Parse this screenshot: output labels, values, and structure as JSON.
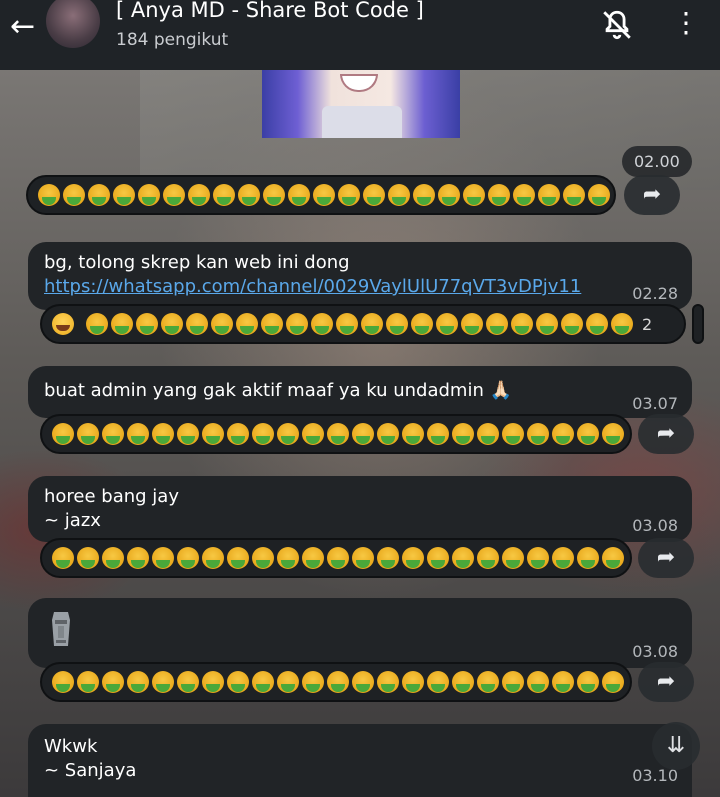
{
  "header": {
    "title": "[ Anya MD - Share Bot Code ]",
    "subtitle": "184 pengikut"
  },
  "icons": {
    "back": "arrow-left-icon",
    "mute": "bell-off-icon",
    "more": "more-vertical-icon",
    "forward": "share-forward-icon",
    "scroll_down": "double-chevron-down-icon"
  },
  "messages": [
    {
      "time": "02.00"
    },
    {
      "text": "bg, tolong skrep kan web ini dong",
      "link": "https://whatsapp.com/channel/0029VaylUlU77qVT3vDPjv11",
      "time": "02.28",
      "reaction_count": "2"
    },
    {
      "text": "buat admin yang gak aktif maaf ya ku undadmin 🙏🏻",
      "time": "03.07"
    },
    {
      "text": "horee bang jay",
      "author": "~ jazx",
      "time": "03.08"
    },
    {
      "time": "03.08"
    },
    {
      "text": "Wkwk",
      "author": "~ Sanjaya",
      "time": "03.10"
    }
  ],
  "colors": {
    "header_bg": "#1f2327",
    "bubble_bg": "#212427",
    "link": "#5aa8ea"
  }
}
